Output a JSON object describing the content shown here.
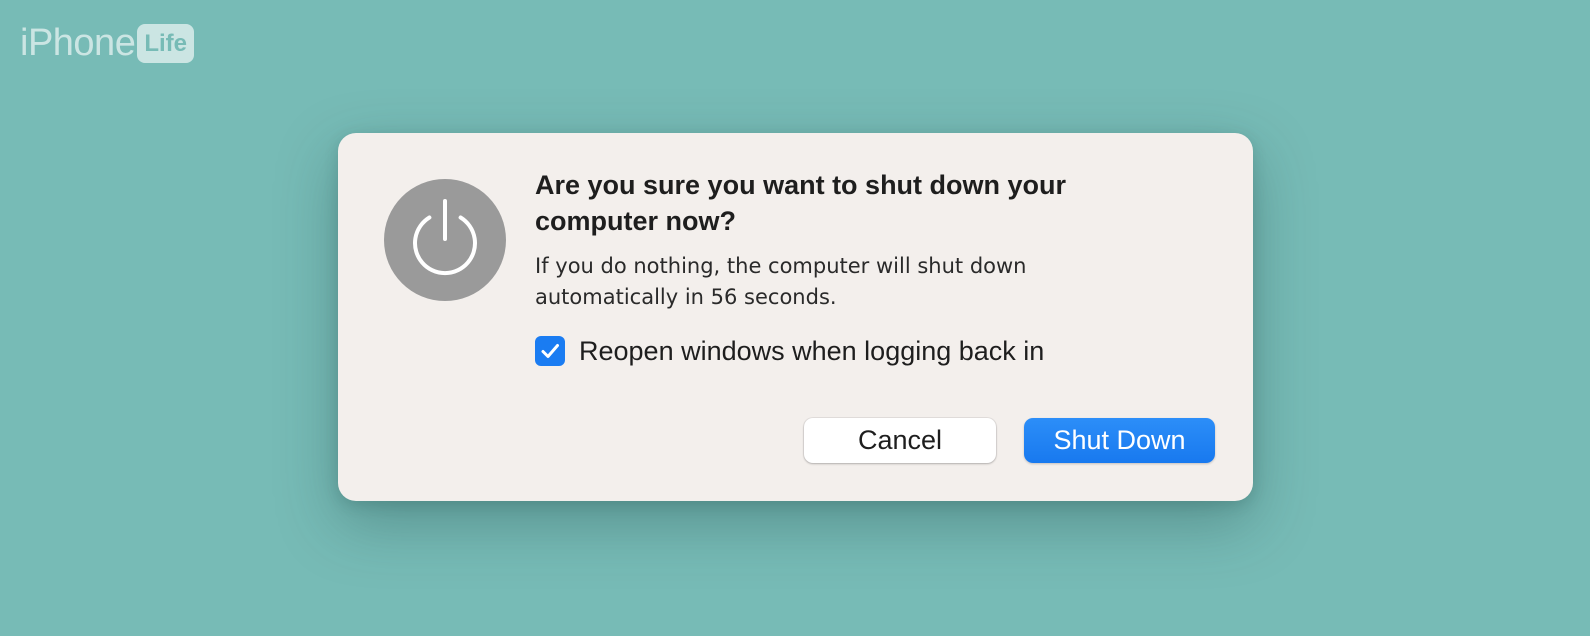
{
  "watermark": {
    "brand_text": "iPhone",
    "brand_box_text": "Life"
  },
  "dialog": {
    "icon": "power-icon",
    "title": "Are you sure you want to shut down your computer now?",
    "message": "If you do nothing, the computer will shut down automatically in 56 seconds.",
    "countdown_seconds": 56,
    "checkbox": {
      "label": "Reopen windows when logging back in",
      "checked": true,
      "icon": "checkmark-icon"
    },
    "buttons": {
      "cancel_label": "Cancel",
      "shutdown_label": "Shut Down"
    }
  },
  "colors": {
    "background": "#77bbb6",
    "dialog_background": "#f3efec",
    "accent": "#1a7cf2",
    "icon_circle": "#9a9a9a"
  }
}
